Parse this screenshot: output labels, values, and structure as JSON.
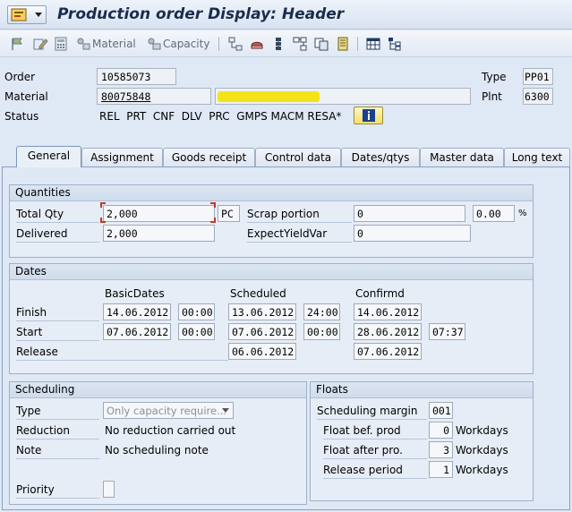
{
  "window": {
    "title": "Production order Display: Header"
  },
  "toolbar": {
    "material_label": "Material",
    "capacity_label": "Capacity"
  },
  "header": {
    "order_label": "Order",
    "order_value": "10585073",
    "material_label": "Material",
    "material_value": "80075848",
    "material_desc": "",
    "status_label": "Status",
    "status_value": "REL  PRT  CNF  DLV  PRC  GMPS MACM RESA*",
    "type_label": "Type",
    "type_value": "PP01",
    "plant_label": "Plnt",
    "plant_value": "6300"
  },
  "tabs": [
    {
      "label": "General",
      "active": true
    },
    {
      "label": "Assignment"
    },
    {
      "label": "Goods receipt"
    },
    {
      "label": "Control data"
    },
    {
      "label": "Dates/qtys"
    },
    {
      "label": "Master data"
    },
    {
      "label": "Long text"
    }
  ],
  "quantities": {
    "title": "Quantities",
    "total_qty_label": "Total Qty",
    "total_qty_value": "2,000",
    "unit": "PC",
    "delivered_label": "Delivered",
    "delivered_value": "2,000",
    "scrap_label": "Scrap portion",
    "scrap_value": "0",
    "scrap_pct": "0.00",
    "pct_sign": "%",
    "yield_label": "ExpectYieldVar",
    "yield_value": "0"
  },
  "dates": {
    "title": "Dates",
    "col_basic": "BasicDates",
    "col_scheduled": "Scheduled",
    "col_confirmed": "Confirmd",
    "finish_label": "Finish",
    "start_label": "Start",
    "release_label": "Release",
    "finish_basic_date": "14.06.2012",
    "finish_basic_time": "00:00",
    "finish_sched_date": "13.06.2012",
    "finish_sched_time": "24:00",
    "finish_conf_date": "14.06.2012",
    "start_basic_date": "07.06.2012",
    "start_basic_time": "00:00",
    "start_sched_date": "07.06.2012",
    "start_sched_time": "00:00",
    "start_conf_date": "28.06.2012",
    "start_conf_time": "07:37",
    "release_sched_date": "06.06.2012",
    "release_conf_date": "07.06.2012"
  },
  "scheduling": {
    "title": "Scheduling",
    "type_label": "Type",
    "type_value": "Only capacity require...",
    "reduction_label": "Reduction",
    "reduction_value": "No reduction carried out",
    "note_label": "Note",
    "note_value": "No scheduling note",
    "priority_label": "Priority"
  },
  "floats": {
    "title": "Floats",
    "margin_label": "Scheduling margin",
    "margin_value": "001",
    "bef_label": "Float bef. prod",
    "bef_value": "0",
    "after_label": "Float after pro.",
    "after_value": "3",
    "release_label": "Release period",
    "release_value": "1",
    "unit": "Workdays"
  }
}
